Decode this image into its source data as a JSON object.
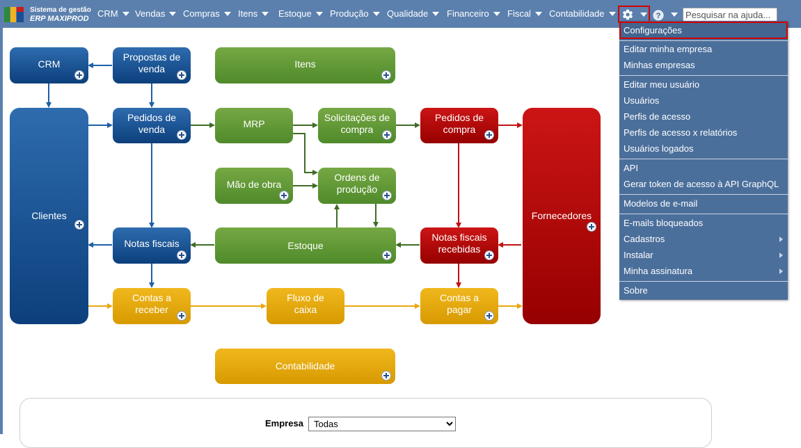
{
  "app": {
    "logo_line1": "Sistema de gestão",
    "logo_line2": "ERP MAXIPROD"
  },
  "nav": {
    "items": [
      "CRM",
      "Vendas",
      "Compras",
      "Itens",
      "Estoque",
      "Produção",
      "Qualidade",
      "Financeiro",
      "Fiscal",
      "Contabilidade"
    ],
    "search_placeholder": "Pesquisar na ajuda..."
  },
  "menu": {
    "items": [
      {
        "label": "Configurações",
        "highlighted": true
      },
      {
        "label": "Editar minha empresa"
      },
      {
        "label": "Minhas empresas"
      },
      {
        "label": "Editar meu usuário"
      },
      {
        "label": "Usuários"
      },
      {
        "label": "Perfis de acesso"
      },
      {
        "label": "Perfis de acesso x relatórios"
      },
      {
        "label": "Usuários logados"
      },
      {
        "label": "API"
      },
      {
        "label": "Gerar token de acesso à API GraphQL"
      },
      {
        "label": "Modelos de e-mail"
      },
      {
        "label": "E-mails bloqueados"
      },
      {
        "label": "Cadastros",
        "submenu": true
      },
      {
        "label": "Instalar",
        "submenu": true
      },
      {
        "label": "Minha assinatura",
        "submenu": true
      },
      {
        "label": "Sobre"
      }
    ]
  },
  "flow": {
    "crm": "CRM",
    "propostas": "Propostas de venda",
    "itens": "Itens",
    "clientes": "Clientes",
    "pedidos_venda": "Pedidos de venda",
    "mrp": "MRP",
    "solicitacoes": "Solicitações de compra",
    "pedidos_compra": "Pedidos de compra",
    "fornecedores": "Fornecedores",
    "mao_obra": "Mão de obra",
    "ordens": "Ordens de produção",
    "notas_fiscais": "Notas fiscais",
    "estoque": "Estoque",
    "notas_recebidas": "Notas fiscais recebidas",
    "contas_receber": "Contas a receber",
    "fluxo_caixa": "Fluxo de caixa",
    "contas_pagar": "Contas a pagar",
    "contabilidade": "Contabilidade"
  },
  "filter": {
    "empresa_label": "Empresa",
    "empresa_value": "Todas"
  },
  "colors": {
    "nav_bg": "#5b80ae",
    "menu_bg": "#4b6f9b",
    "highlight_border": "#d40000",
    "blue": "#0c3f7c",
    "green": "#4f8a2a",
    "red": "#a00000",
    "gold": "#e3a500"
  }
}
